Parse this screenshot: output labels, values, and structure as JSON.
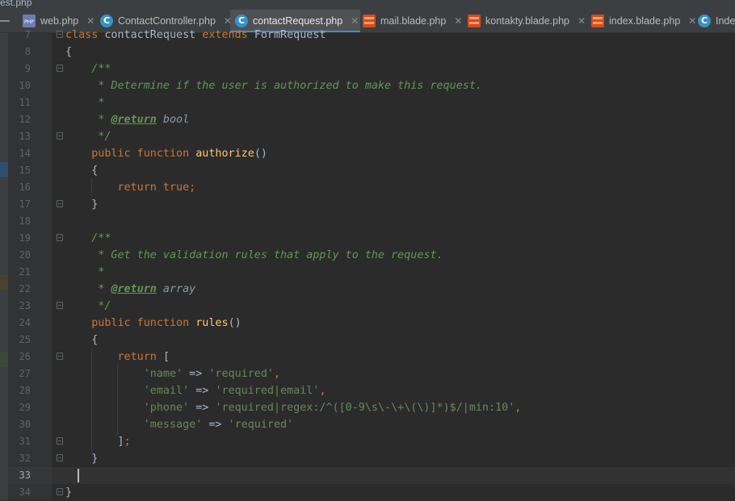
{
  "window": {
    "title_fragment": "est.php"
  },
  "tabs": [
    {
      "label": "web.php",
      "icon": "php-file-icon",
      "active": false
    },
    {
      "label": "ContactController.php",
      "icon": "php-class-icon",
      "active": false
    },
    {
      "label": "contactRequest.php",
      "icon": "php-class-icon",
      "active": true
    },
    {
      "label": "mail.blade.php",
      "icon": "blade-file-icon",
      "active": false
    },
    {
      "label": "kontakty.blade.php",
      "icon": "blade-file-icon",
      "active": false
    },
    {
      "label": "index.blade.php",
      "icon": "blade-file-icon",
      "active": false
    },
    {
      "label": "Index",
      "icon": "php-class-icon",
      "active": false
    }
  ],
  "editor": {
    "current_line": 33,
    "lines": [
      {
        "n": 7,
        "tokens": [
          [
            "k",
            "class "
          ],
          [
            "",
            "contactRequest "
          ],
          [
            "k",
            "extends "
          ],
          [
            "",
            "FormRequest"
          ]
        ]
      },
      {
        "n": 8,
        "tokens": [
          [
            "",
            "{"
          ]
        ]
      },
      {
        "n": 9,
        "tokens": [
          [
            "",
            "    "
          ],
          [
            "c",
            "/**"
          ]
        ]
      },
      {
        "n": 10,
        "tokens": [
          [
            "",
            "    "
          ],
          [
            "c",
            " * Determine if the user is authorized to make this request."
          ]
        ]
      },
      {
        "n": 11,
        "tokens": [
          [
            "",
            "    "
          ],
          [
            "c",
            " *"
          ]
        ]
      },
      {
        "n": 12,
        "tokens": [
          [
            "",
            "    "
          ],
          [
            "c",
            " * "
          ],
          [
            "tag",
            "@return"
          ],
          [
            "tv",
            " bool"
          ]
        ]
      },
      {
        "n": 13,
        "tokens": [
          [
            "",
            "    "
          ],
          [
            "c",
            " */"
          ]
        ]
      },
      {
        "n": 14,
        "tokens": [
          [
            "",
            "    "
          ],
          [
            "k",
            "public function "
          ],
          [
            "f",
            "authorize"
          ],
          [
            "",
            "()"
          ]
        ]
      },
      {
        "n": 15,
        "tokens": [
          [
            "",
            "    {"
          ]
        ]
      },
      {
        "n": 16,
        "tokens": [
          [
            "",
            "        "
          ],
          [
            "k",
            "return true;"
          ]
        ]
      },
      {
        "n": 17,
        "tokens": [
          [
            "",
            "    }"
          ]
        ]
      },
      {
        "n": 18,
        "tokens": []
      },
      {
        "n": 19,
        "tokens": [
          [
            "",
            "    "
          ],
          [
            "c",
            "/**"
          ]
        ]
      },
      {
        "n": 20,
        "tokens": [
          [
            "",
            "    "
          ],
          [
            "c",
            " * Get the validation rules that apply to the request."
          ]
        ]
      },
      {
        "n": 21,
        "tokens": [
          [
            "",
            "    "
          ],
          [
            "c",
            " *"
          ]
        ]
      },
      {
        "n": 22,
        "tokens": [
          [
            "",
            "    "
          ],
          [
            "c",
            " * "
          ],
          [
            "tag",
            "@return"
          ],
          [
            "tv",
            " array"
          ]
        ]
      },
      {
        "n": 23,
        "tokens": [
          [
            "",
            "    "
          ],
          [
            "c",
            " */"
          ]
        ]
      },
      {
        "n": 24,
        "tokens": [
          [
            "",
            "    "
          ],
          [
            "k",
            "public function "
          ],
          [
            "f",
            "rules"
          ],
          [
            "",
            "()"
          ]
        ]
      },
      {
        "n": 25,
        "tokens": [
          [
            "",
            "    {"
          ]
        ]
      },
      {
        "n": 26,
        "tokens": [
          [
            "",
            "        "
          ],
          [
            "k",
            "return "
          ],
          [
            "",
            "["
          ]
        ]
      },
      {
        "n": 27,
        "tokens": [
          [
            "",
            "            "
          ],
          [
            "s",
            "'name'"
          ],
          [
            "",
            " => "
          ],
          [
            "s",
            "'required'"
          ],
          [
            "k",
            ","
          ]
        ]
      },
      {
        "n": 28,
        "tokens": [
          [
            "",
            "            "
          ],
          [
            "s",
            "'email'"
          ],
          [
            "",
            " => "
          ],
          [
            "s",
            "'required|email'"
          ],
          [
            "k",
            ","
          ]
        ]
      },
      {
        "n": 29,
        "tokens": [
          [
            "",
            "            "
          ],
          [
            "s",
            "'phone'"
          ],
          [
            "",
            " => "
          ],
          [
            "s",
            "'required|regex:/^([0-9\\s\\-\\+\\(\\)]*)$/|min:10'"
          ],
          [
            "k",
            ","
          ]
        ]
      },
      {
        "n": 30,
        "tokens": [
          [
            "",
            "            "
          ],
          [
            "s",
            "'message'"
          ],
          [
            "",
            " => "
          ],
          [
            "s",
            "'required'"
          ]
        ]
      },
      {
        "n": 31,
        "tokens": [
          [
            "",
            "        "
          ],
          [
            "",
            "]"
          ],
          [
            "k",
            ";"
          ]
        ]
      },
      {
        "n": 32,
        "tokens": [
          [
            "",
            "    }"
          ]
        ]
      },
      {
        "n": 33,
        "tokens": []
      },
      {
        "n": 34,
        "tokens": [
          [
            "",
            "}"
          ]
        ]
      }
    ]
  },
  "colors": {
    "keyword": "#cc7832",
    "function": "#ffc66d",
    "string": "#6a8759",
    "comment": "#629755",
    "text": "#a9b7c6",
    "active_tab_underline": "#4a88c7"
  }
}
